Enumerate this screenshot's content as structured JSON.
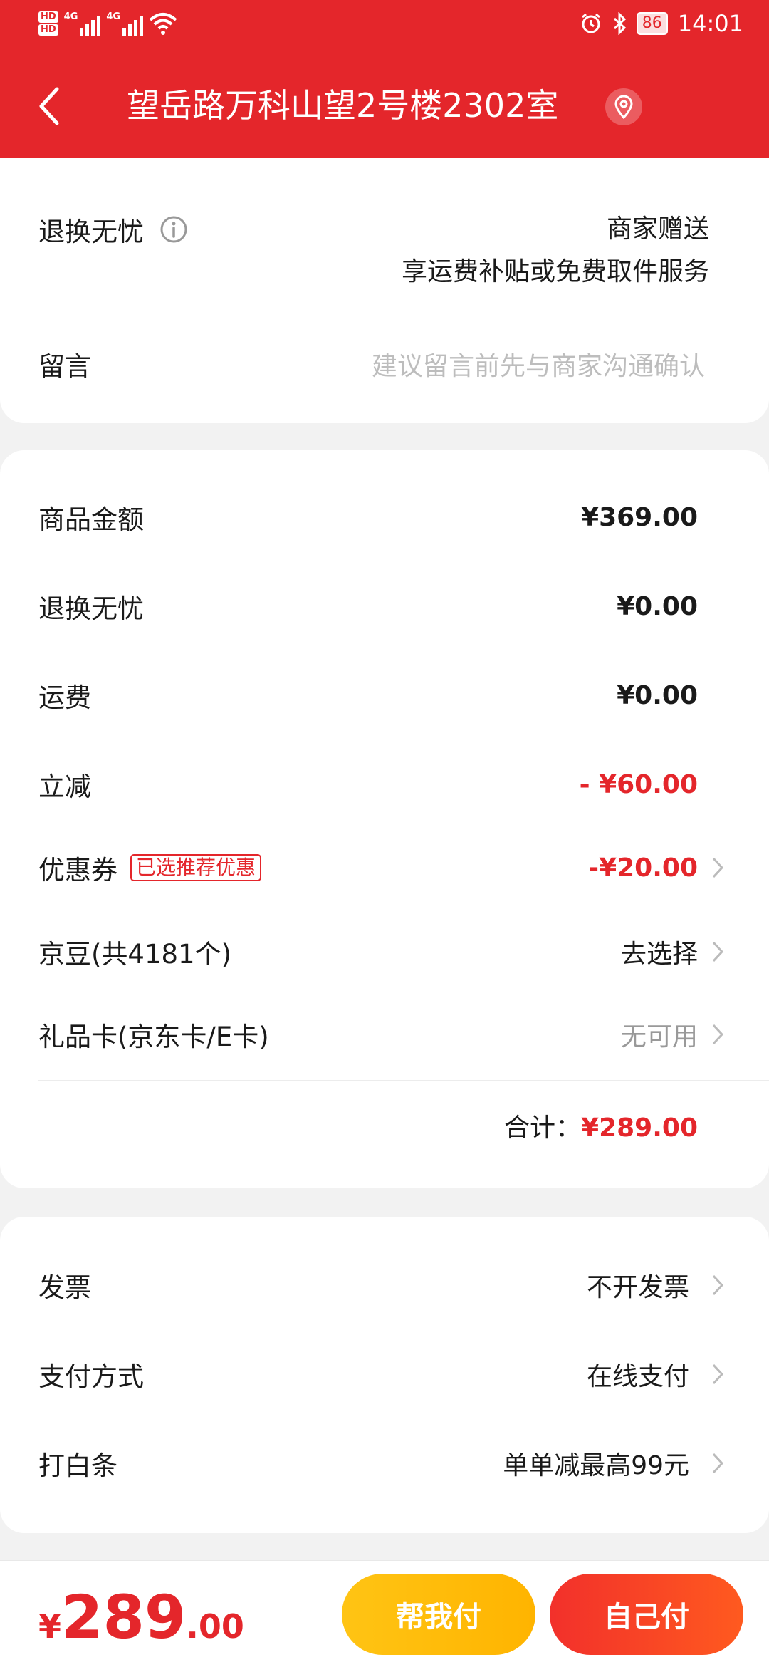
{
  "status_bar": {
    "hd1": "HD",
    "hd2": "HD",
    "sig1_label": "4G",
    "sig2_label": "4G",
    "battery": "86",
    "time": "14:01"
  },
  "header": {
    "title": "望岳路万科山望2号楼2302室"
  },
  "service": {
    "label": "退换无忧",
    "line1": "商家赠送",
    "line2": "享运费补贴或免费取件服务"
  },
  "message": {
    "label": "留言",
    "placeholder": "建议留言前先与商家沟通确认"
  },
  "summary": {
    "goods_label": "商品金额",
    "goods_value": "¥369.00",
    "return_label": "退换无忧",
    "return_value": "¥0.00",
    "shipping_label": "运费",
    "shipping_value": "¥0.00",
    "discount_label": "立减",
    "discount_value": "- ¥60.00",
    "coupon_label": "优惠券",
    "coupon_tag": "已选推荐优惠",
    "coupon_value": "-¥20.00",
    "beans_label": "京豆(共4181个)",
    "beans_value": "去选择",
    "giftcard_label": "礼品卡(京东卡/E卡)",
    "giftcard_value": "无可用",
    "total_label": "合计：",
    "total_value": "¥289.00"
  },
  "options": {
    "invoice_label": "发票",
    "invoice_value": "不开发票",
    "payment_label": "支付方式",
    "payment_value": "在线支付",
    "baitiao_label": "打白条",
    "baitiao_value": "单单减最高99元"
  },
  "bottom": {
    "currency": "¥",
    "price_int": "289",
    "price_dec": ".00",
    "help_pay": "帮我付",
    "self_pay": "自己付"
  },
  "colors": {
    "brand_red": "#e4262b",
    "help_yellow": "#ffc414"
  }
}
